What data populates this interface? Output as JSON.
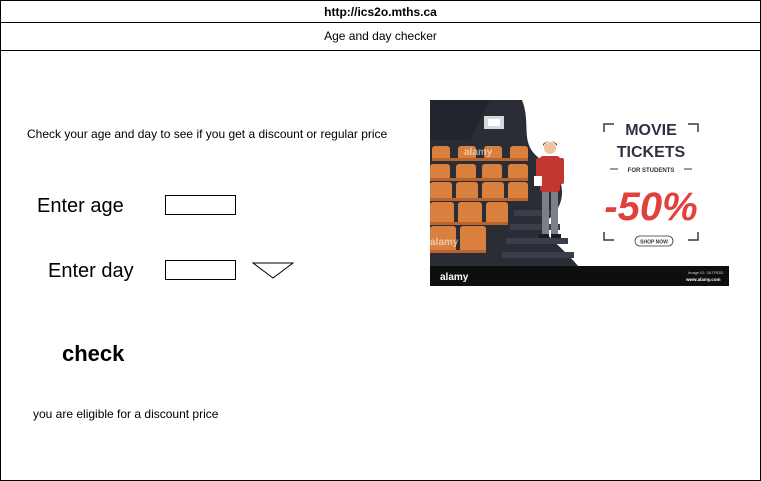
{
  "browser": {
    "url": "http://ics2o.mths.ca"
  },
  "page": {
    "title": "Age and day checker",
    "intro": "Check your age and day to see if you get a discount or regular price"
  },
  "form": {
    "age_label": "Enter age",
    "age_value": "",
    "day_label": "Enter day",
    "day_value": "",
    "check_label": "check"
  },
  "result": {
    "message": "you are eligible for a discount price"
  },
  "ad": {
    "headline_line1": "MOVIE",
    "headline_line2": "TICKETS",
    "subline": "FOR STUDENTS",
    "discount": "-50%",
    "cta": "SHOP NOW",
    "watermark": "alamy",
    "footer_brand": "alamy",
    "footer_id": "Image ID: 2A7F53D",
    "footer_site": "www.alamy.com",
    "colors": {
      "discount_red": "#e2403c",
      "seat_orange": "#d9803e",
      "hall_dark": "#2a2d36",
      "footer_black": "#0e0e0e"
    }
  }
}
